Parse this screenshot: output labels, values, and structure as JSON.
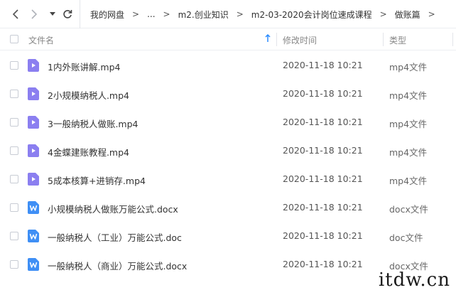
{
  "toolbar": {
    "back_icon": "chevron-left-icon",
    "forward_icon": "chevron-right-icon",
    "dropdown_icon": "caret-down-icon",
    "refresh_icon": "refresh-icon",
    "breadcrumbs": [
      "我的网盘",
      "...",
      "m2.创业知识",
      "m2-03-2020会计岗位速成课程",
      "做账篇"
    ],
    "separator": ">"
  },
  "header": {
    "name_label": "文件名",
    "time_label": "修改时间",
    "type_label": "类型",
    "sort_icon": "arrow-up-icon",
    "sort_color": "#2b8cff"
  },
  "files": [
    {
      "name": "1内外账讲解.mp4",
      "modified": "2020-11-18 10:21",
      "type": "mp4文件",
      "icon": "video-file-icon"
    },
    {
      "name": "2小规模纳税人.mp4",
      "modified": "2020-11-18 10:21",
      "type": "mp4文件",
      "icon": "video-file-icon"
    },
    {
      "name": "3一般纳税人做账.mp4",
      "modified": "2020-11-18 10:21",
      "type": "mp4文件",
      "icon": "video-file-icon"
    },
    {
      "name": "4金蝶建账教程.mp4",
      "modified": "2020-11-18 10:21",
      "type": "mp4文件",
      "icon": "video-file-icon"
    },
    {
      "name": "5成本核算+进销存.mp4",
      "modified": "2020-11-18 10:21",
      "type": "mp4文件",
      "icon": "video-file-icon"
    },
    {
      "name": "小规模纳税人做账万能公式.docx",
      "modified": "2020-11-18 10:21",
      "type": "docx文件",
      "icon": "word-file-icon"
    },
    {
      "name": "一般纳税人（工业）万能公式.doc",
      "modified": "2020-11-18 10:21",
      "type": "doc文件",
      "icon": "word-file-icon"
    },
    {
      "name": "一般纳税人（商业）万能公式.docx",
      "modified": "2020-11-18 10:21",
      "type": "docx文件",
      "icon": "word-file-icon"
    }
  ],
  "colors": {
    "video_icon": "#8b7ff0",
    "word_icon": "#3f8ff5"
  },
  "watermark": "itdw.cn"
}
